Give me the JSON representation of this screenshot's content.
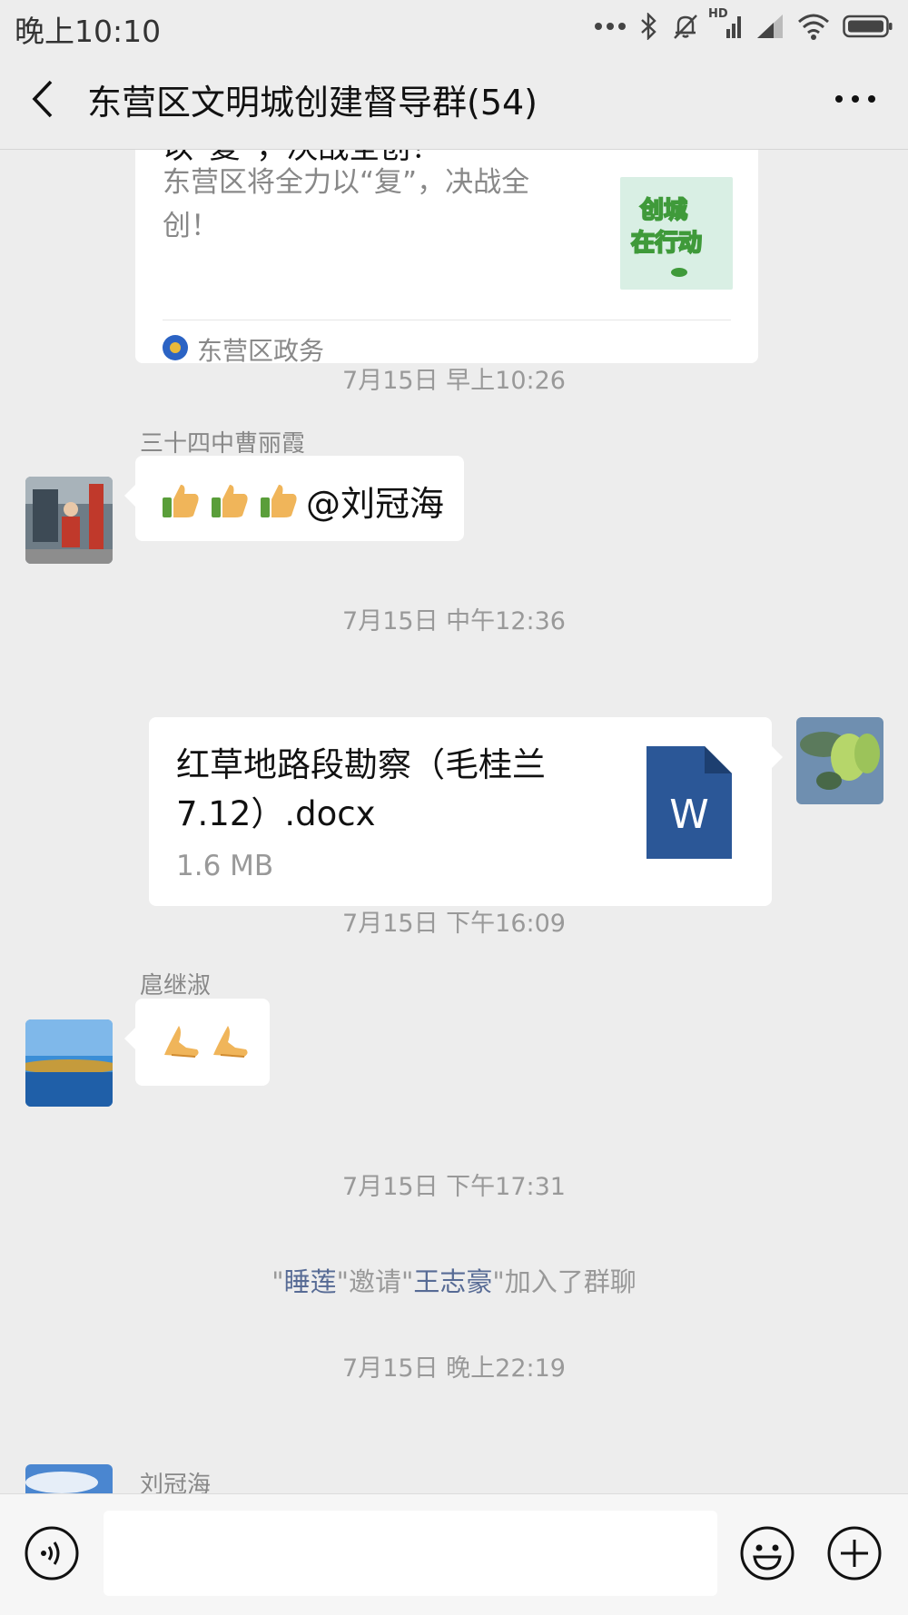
{
  "status_bar": {
    "time": "晚上10:10",
    "hd_label": "HD"
  },
  "header": {
    "title": "东营区文明城创建督导群(54)"
  },
  "article_card": {
    "cut_title": "以“复”，决战全创！",
    "description": "东营区将全力以“复”，决战全创！",
    "thumbnail_line1": "创城",
    "thumbnail_line2": "在行动",
    "source": "东营区政务"
  },
  "messages": {
    "ts1": "7月15日 早上10:26",
    "m1_sender": "三十四中曹丽霞",
    "m1_mention": "@刘冠海",
    "ts2": "7月15日 中午12:36",
    "file_name": "红草地路段勘察（毛桂兰7.12）.docx",
    "file_size": "1.6 MB",
    "file_icon_letter": "W",
    "ts3": "7月15日 下午16:09",
    "m3_sender": "扈继淑",
    "ts4": "7月15日 下午17:31",
    "sys_q1": "\"",
    "sys_inviter": "睡莲",
    "sys_q2": "\"邀请\"",
    "sys_invitee": "王志豪",
    "sys_tail": "\"加入了群聊",
    "ts5": "7月15日 晚上22:19",
    "m4_sender": "刘冠海"
  },
  "input_bar": {
    "placeholder": ""
  },
  "colors": {
    "background": "#ededed",
    "bubble": "#ffffff",
    "link_name": "#576b95",
    "word_blue": "#2b5797"
  },
  "icons": [
    "back-arrow-icon",
    "more-icon",
    "voice-icon",
    "emoji-icon",
    "plus-icon",
    "word-file-icon",
    "thumbs-up-icon",
    "praying-hands-icon",
    "bluetooth-icon",
    "mute-bell-icon",
    "signal-icon",
    "wifi-icon",
    "battery-icon"
  ]
}
